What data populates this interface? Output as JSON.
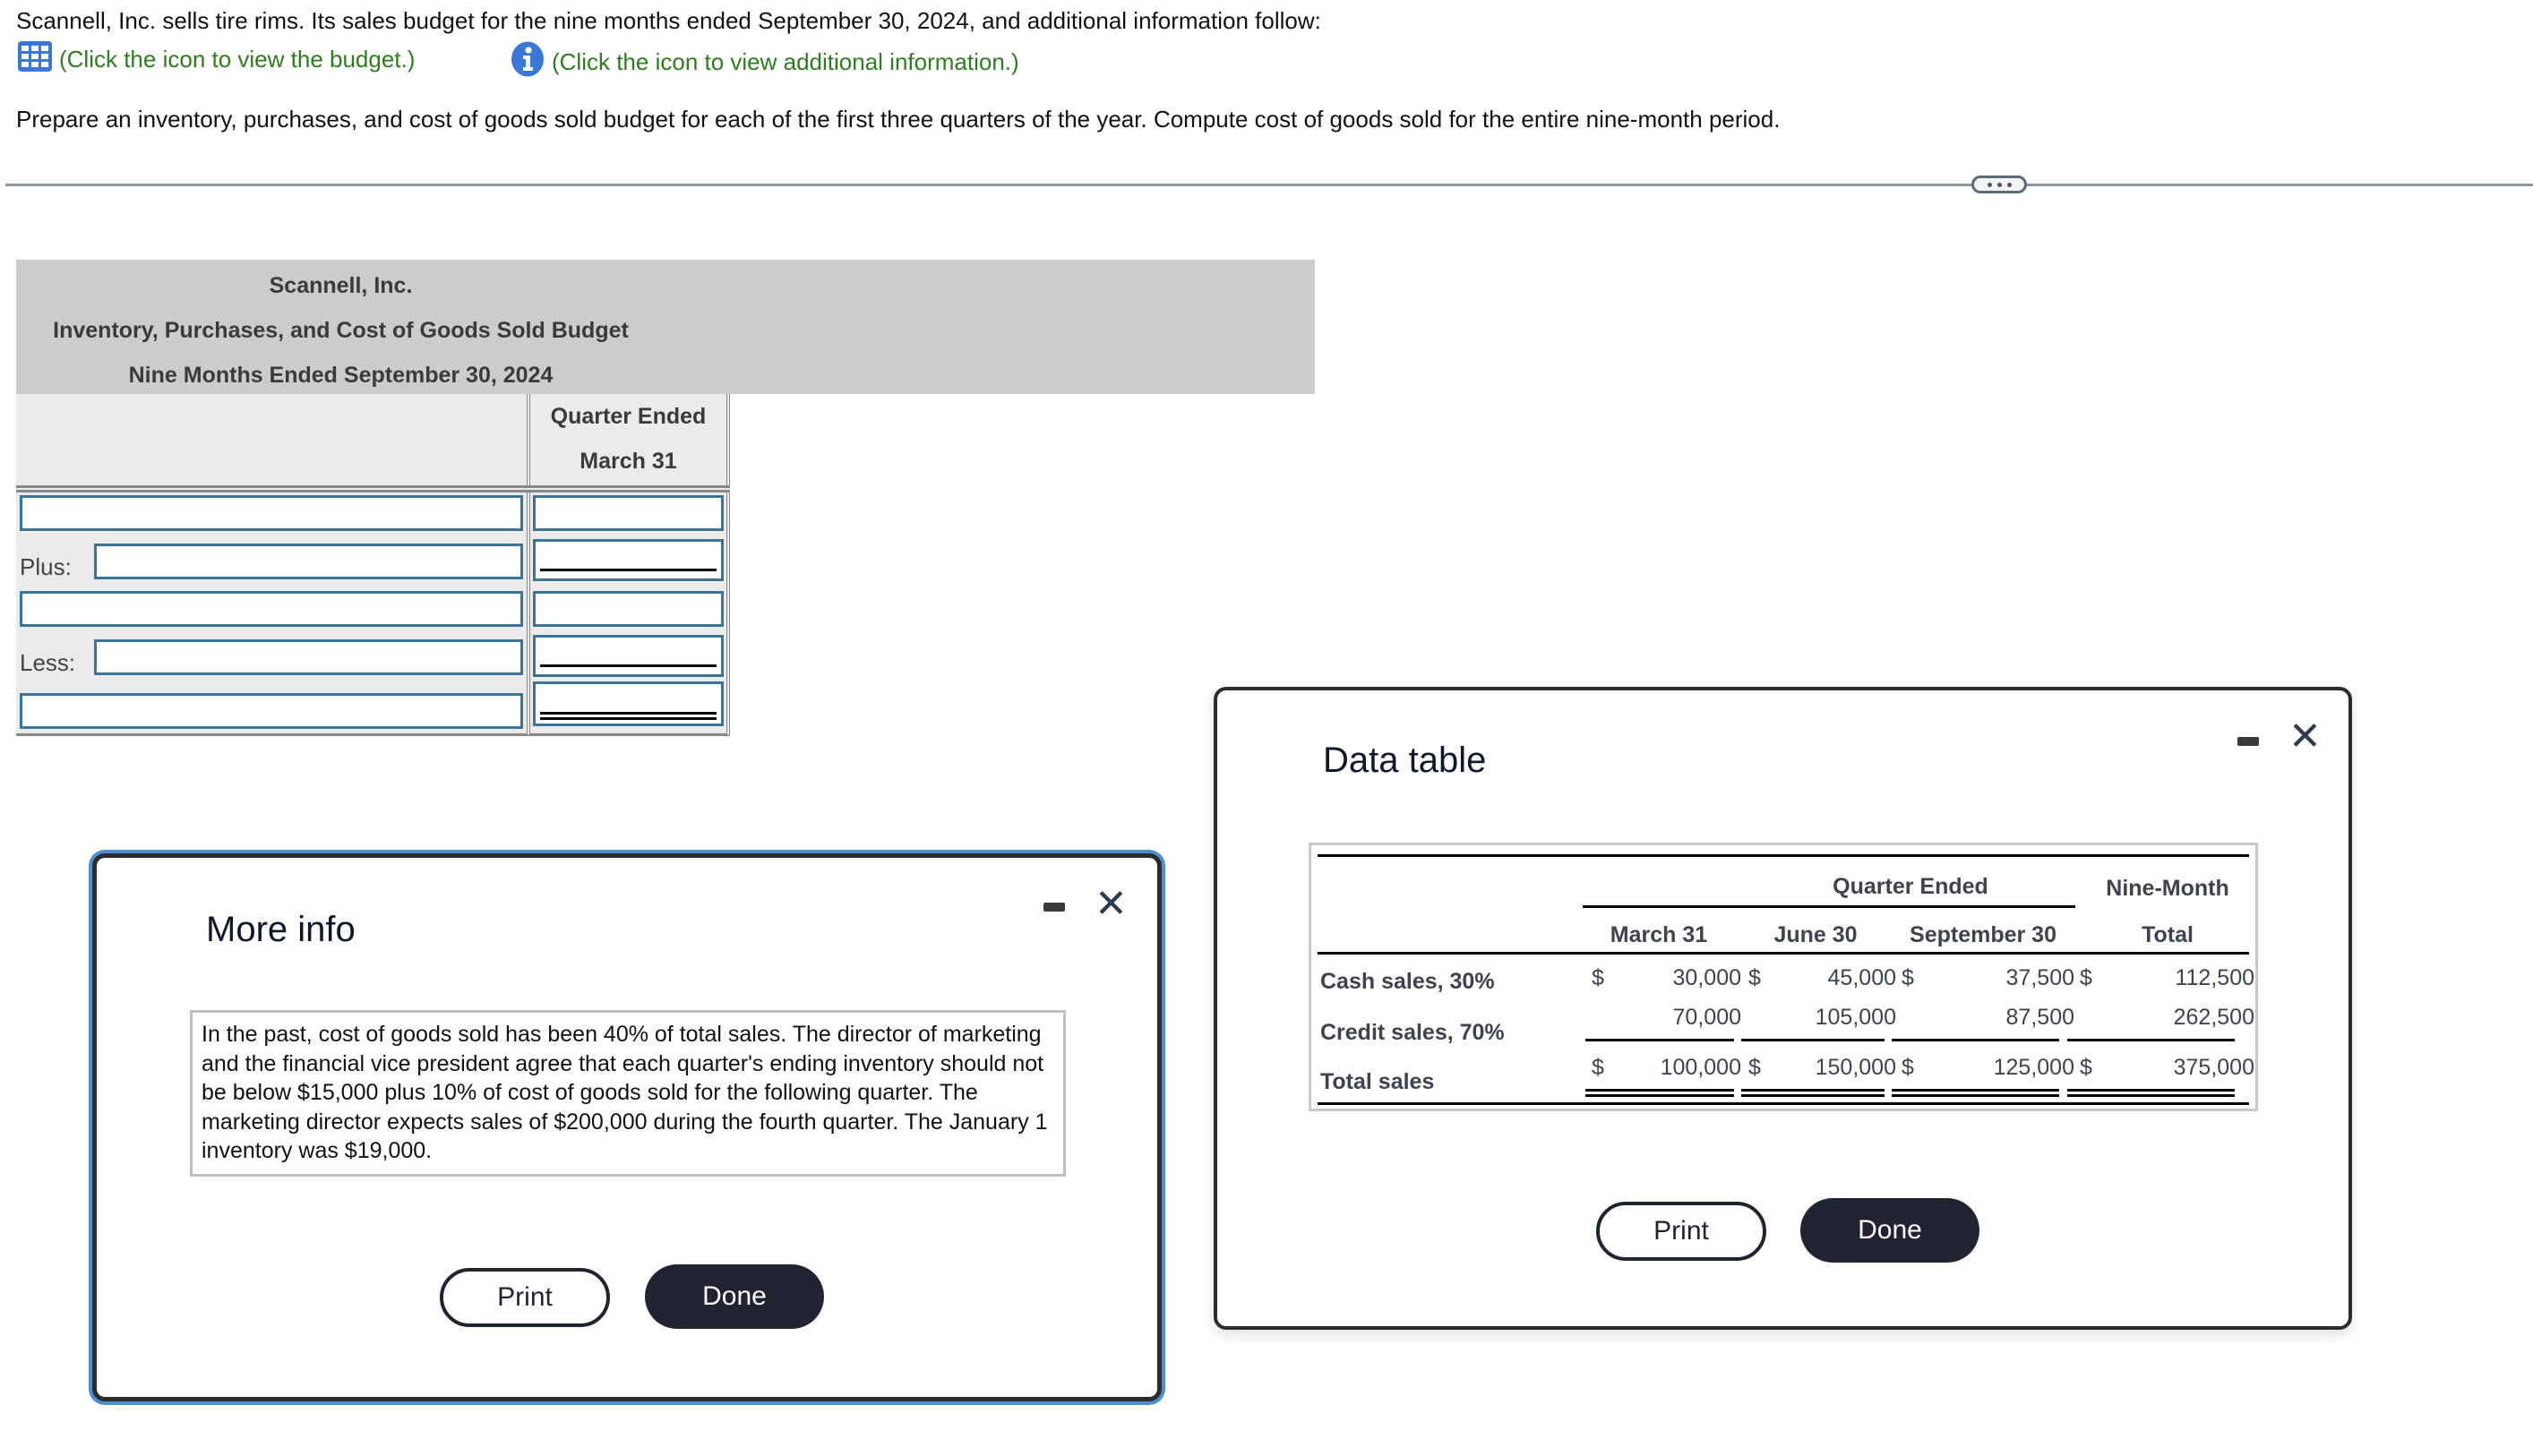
{
  "intro": "Scannell, Inc. sells tire rims. Its sales budget for the nine months ended September 30, 2024, and additional information follow:",
  "links": {
    "budget": {
      "icon": "table-grid-icon",
      "label": "(Click the icon to view the budget.)"
    },
    "info": {
      "icon": "info-icon",
      "label": "(Click the icon to view additional information.)"
    }
  },
  "instruction": "Prepare an inventory, purchases, and cost of goods sold budget for each of the first three quarters of the year. Compute cost of goods sold for the entire nine-month period.",
  "colors": {
    "link": "#2e7d1e",
    "icon_blue": "#3a78d8",
    "input_border": "#3a7597",
    "button_dark": "#1f2430",
    "popup_accent": "#4a90d0"
  },
  "budget": {
    "company": "Scannell, Inc.",
    "title": "Inventory, Purchases, and Cost of Goods Sold Budget",
    "period": "Nine Months Ended September 30, 2024",
    "col_header_1": "Quarter Ended",
    "col_header_2": "March 31",
    "rows": [
      {
        "prefix": "",
        "label_value": "",
        "amount_value": ""
      },
      {
        "prefix": "Plus:",
        "label_value": "",
        "amount_value": ""
      },
      {
        "prefix": "",
        "label_value": "",
        "amount_value": ""
      },
      {
        "prefix": "Less:",
        "label_value": "",
        "amount_value": ""
      },
      {
        "prefix": "",
        "label_value": "",
        "amount_value": ""
      }
    ]
  },
  "more_info": {
    "title": "More info",
    "text": "In the past, cost of goods sold has been 40% of total sales. The director of marketing and the financial vice president agree that each quarter's ending inventory should not be below $15,000 plus 10% of cost of goods sold for the following quarter. The marketing director expects sales of $200,000 during the fourth quarter. The January 1 inventory was $19,000.",
    "print_label": "Print",
    "done_label": "Done"
  },
  "data_table": {
    "title": "Data table",
    "group_header": "Quarter Ended",
    "total_header_1": "Nine-Month",
    "total_header_2": "Total",
    "columns": [
      "March 31",
      "June 30",
      "September 30",
      "Total"
    ],
    "currency": "$",
    "rows": [
      {
        "label": "Cash sales, 30%",
        "values": [
          "30,000",
          "45,000",
          "37,500",
          "112,500"
        ],
        "dollar": true
      },
      {
        "label": "Credit sales, 70%",
        "values": [
          "70,000",
          "105,000",
          "87,500",
          "262,500"
        ],
        "dollar": false
      },
      {
        "label": "Total sales",
        "values": [
          "100,000",
          "150,000",
          "125,000",
          "375,000"
        ],
        "dollar": true
      }
    ],
    "print_label": "Print",
    "done_label": "Done"
  }
}
